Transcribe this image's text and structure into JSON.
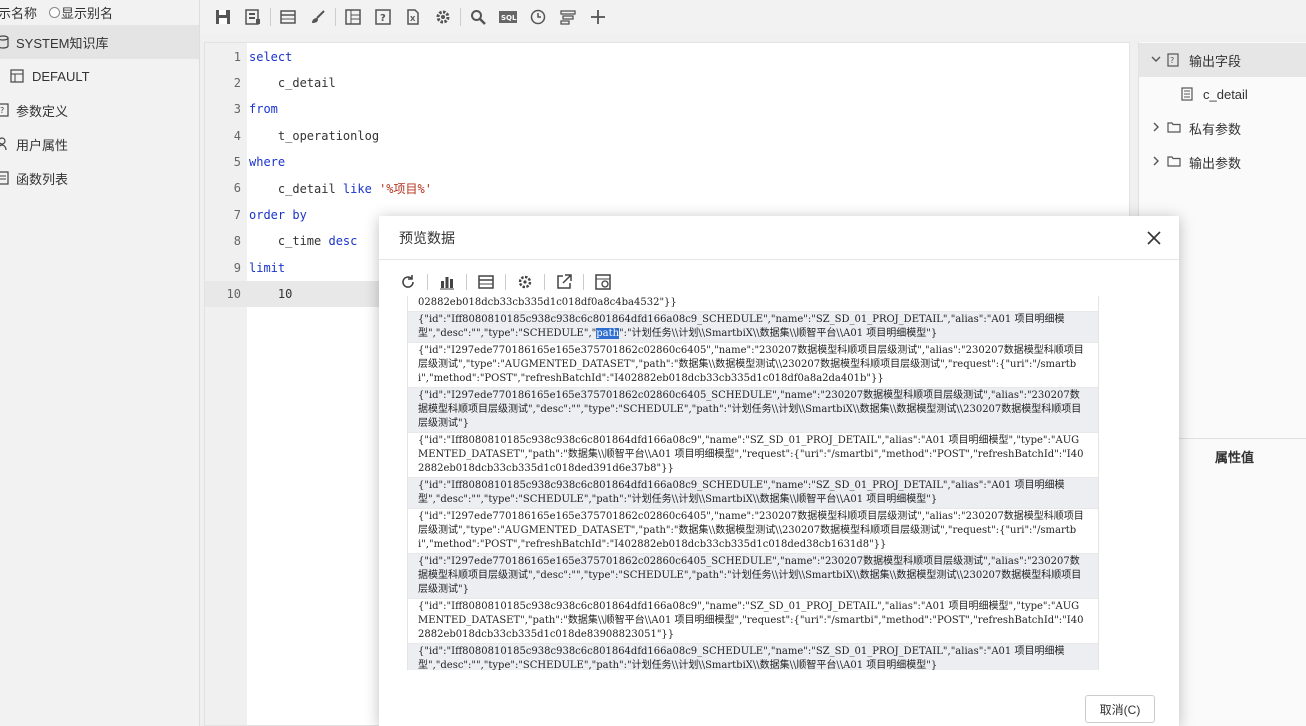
{
  "left": {
    "display_name_label": "示名称",
    "show_alias_label": "显示别名",
    "items": [
      {
        "label": "SYSTEM知识库"
      },
      {
        "label": "DEFAULT"
      },
      {
        "label": "参数定义"
      },
      {
        "label": "用户属性"
      },
      {
        "label": "函数列表"
      }
    ]
  },
  "editor": {
    "lines": [
      {
        "n": "1",
        "code": "select"
      },
      {
        "n": "2",
        "code": "    c_detail"
      },
      {
        "n": "3",
        "code": "from"
      },
      {
        "n": "4",
        "code": "    t_operationlog"
      },
      {
        "n": "5",
        "code": "where"
      },
      {
        "n": "6",
        "code": "    c_detail like '%项目%'"
      },
      {
        "n": "7",
        "code": "order by"
      },
      {
        "n": "8",
        "code": "    c_time desc"
      },
      {
        "n": "9",
        "code": "limit"
      },
      {
        "n": "10",
        "code": "    10"
      }
    ]
  },
  "right": {
    "output_fields": "输出字段",
    "field_c_detail": "c_detail",
    "private_params": "私有参数",
    "output_params": "输出参数",
    "property_value": "属性值"
  },
  "dialog": {
    "title": "预览数据",
    "cancel": "取消(C)",
    "rows": [
      {
        "pre": "02882eb018dcb33cb335d1c018df0a8c4ba4532\"}}",
        "hl": "",
        "post": ""
      },
      {
        "pre": "{\"id\":\"Iff8080810185c938c938c6c801864dfd166a08c9_SCHEDULE\",\"name\":\"SZ_SD_01_PROJ_DETAIL\",\"alias\":\"A01 项目明细模型\",\"desc\":\"\",\"type\":\"SCHEDULE\",\"",
        "hl": "path",
        "post": "\":\"计划任务\\\\计划\\\\SmartbiX\\\\数据集\\\\顺智平台\\\\A01 项目明细模型\"}"
      },
      {
        "pre": "{\"id\":\"I297ede770186165e165e375701862c02860c6405\",\"name\":\"230207数据模型科顺项目层级测试\",\"alias\":\"230207数据模型科顺项目层级测试\",\"type\":\"AUGMENTED_DATASET\",\"path\":\"数据集\\\\数据模型测试\\\\230207数据模型科顺项目层级测试\",\"request\":{\"uri\":\"/smartbi\",\"method\":\"POST\",\"refreshBatchId\":\"I402882eb018dcb33cb335d1c018df0a8a2da401b\"}}",
        "hl": "",
        "post": ""
      },
      {
        "pre": "{\"id\":\"I297ede770186165e165e375701862c02860c6405_SCHEDULE\",\"name\":\"230207数据模型科顺项目层级测试\",\"alias\":\"230207数据模型科顺项目层级测试\",\"desc\":\"\",\"type\":\"SCHEDULE\",\"path\":\"计划任务\\\\计划\\\\SmartbiX\\\\数据集\\\\数据模型测试\\\\230207数据模型科顺项目层级测试\"}",
        "hl": "",
        "post": ""
      },
      {
        "pre": "{\"id\":\"Iff8080810185c938c938c6c801864dfd166a08c9\",\"name\":\"SZ_SD_01_PROJ_DETAIL\",\"alias\":\"A01 项目明细模型\",\"type\":\"AUGMENTED_DATASET\",\"path\":\"数据集\\\\顺智平台\\\\A01 项目明细模型\",\"request\":{\"uri\":\"/smartbi\",\"method\":\"POST\",\"refreshBatchId\":\"I402882eb018dcb33cb335d1c018ded391d6e37b8\"}}",
        "hl": "",
        "post": ""
      },
      {
        "pre": "{\"id\":\"Iff8080810185c938c938c6c801864dfd166a08c9_SCHEDULE\",\"name\":\"SZ_SD_01_PROJ_DETAIL\",\"alias\":\"A01 项目明细模型\",\"desc\":\"\",\"type\":\"SCHEDULE\",\"path\":\"计划任务\\\\计划\\\\SmartbiX\\\\数据集\\\\顺智平台\\\\A01 项目明细模型\"}",
        "hl": "",
        "post": ""
      },
      {
        "pre": "{\"id\":\"I297ede770186165e165e375701862c02860c6405\",\"name\":\"230207数据模型科顺项目层级测试\",\"alias\":\"230207数据模型科顺项目层级测试\",\"type\":\"AUGMENTED_DATASET\",\"path\":\"数据集\\\\数据模型测试\\\\230207数据模型科顺项目层级测试\",\"request\":{\"uri\":\"/smartbi\",\"method\":\"POST\",\"refreshBatchId\":\"I402882eb018dcb33cb335d1c018ded38cb1631d8\"}}",
        "hl": "",
        "post": ""
      },
      {
        "pre": "{\"id\":\"I297ede770186165e165e375701862c02860c6405_SCHEDULE\",\"name\":\"230207数据模型科顺项目层级测试\",\"alias\":\"230207数据模型科顺项目层级测试\",\"desc\":\"\",\"type\":\"SCHEDULE\",\"path\":\"计划任务\\\\计划\\\\SmartbiX\\\\数据集\\\\数据模型测试\\\\230207数据模型科顺项目层级测试\"}",
        "hl": "",
        "post": ""
      },
      {
        "pre": "{\"id\":\"Iff8080810185c938c938c6c801864dfd166a08c9\",\"name\":\"SZ_SD_01_PROJ_DETAIL\",\"alias\":\"A01 项目明细模型\",\"type\":\"AUGMENTED_DATASET\",\"path\":\"数据集\\\\顺智平台\\\\A01 项目明细模型\",\"request\":{\"uri\":\"/smartbi\",\"method\":\"POST\",\"refreshBatchId\":\"I402882eb018dcb33cb335d1c018de83908823051\"}}",
        "hl": "",
        "post": ""
      },
      {
        "pre": "{\"id\":\"Iff8080810185c938c938c6c801864dfd166a08c9_SCHEDULE\",\"name\":\"SZ_SD_01_PROJ_DETAIL\",\"alias\":\"A01 项目明细模型\",\"desc\":\"\",\"type\":\"SCHEDULE\",\"path\":\"计划任务\\\\计划\\\\SmartbiX\\\\数据集\\\\顺智平台\\\\A01 项目明细模型\"}",
        "hl": "",
        "post": ""
      }
    ]
  }
}
